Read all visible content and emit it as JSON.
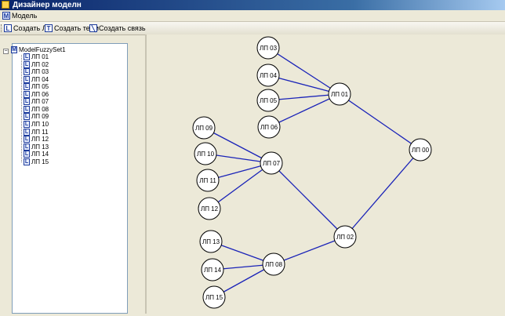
{
  "window": {
    "title": "Дизайнер моделн"
  },
  "menu": {
    "items": [
      {
        "label": "Модель"
      }
    ]
  },
  "toolbar": {
    "buttons": [
      {
        "label": "Создать ЛП",
        "icon": "linguistic-variable-icon"
      },
      {
        "label": "Создать терм",
        "icon": "term-icon"
      },
      {
        "label": "Создать связь",
        "icon": "link-icon"
      }
    ]
  },
  "tree": {
    "root": "ModelFuzzySet1",
    "items": [
      "ЛП 01",
      "ЛП 02",
      "ЛП 03",
      "ЛП 04",
      "ЛП 05",
      "ЛП 06",
      "ЛП 07",
      "ЛП 08",
      "ЛП 09",
      "ЛП 10",
      "ЛП 11",
      "ЛП 12",
      "ЛП 13",
      "ЛП 14",
      "ЛП 15"
    ]
  },
  "graph": {
    "nodes": [
      "ЛП 00",
      "ЛП 01",
      "ЛП 02",
      "ЛП 03",
      "ЛП 04",
      "ЛП 05",
      "ЛП 06",
      "ЛП 07",
      "ЛП 08",
      "ЛП 09",
      "ЛП 10",
      "ЛП 11",
      "ЛП 12",
      "ЛП 13",
      "ЛП 14",
      "ЛП 15"
    ],
    "edges": [
      [
        "ЛП 03",
        "ЛП 01"
      ],
      [
        "ЛП 04",
        "ЛП 01"
      ],
      [
        "ЛП 05",
        "ЛП 01"
      ],
      [
        "ЛП 06",
        "ЛП 01"
      ],
      [
        "ЛП 09",
        "ЛП 07"
      ],
      [
        "ЛП 10",
        "ЛП 07"
      ],
      [
        "ЛП 11",
        "ЛП 07"
      ],
      [
        "ЛП 12",
        "ЛП 07"
      ],
      [
        "ЛП 13",
        "ЛП 08"
      ],
      [
        "ЛП 14",
        "ЛП 08"
      ],
      [
        "ЛП 15",
        "ЛП 08"
      ],
      [
        "ЛП 01",
        "ЛП 00"
      ],
      [
        "ЛП 02",
        "ЛП 00"
      ],
      [
        "ЛП 07",
        "ЛП 02"
      ],
      [
        "ЛП 08",
        "ЛП 02"
      ]
    ],
    "edge_color": "#1a23b8"
  }
}
